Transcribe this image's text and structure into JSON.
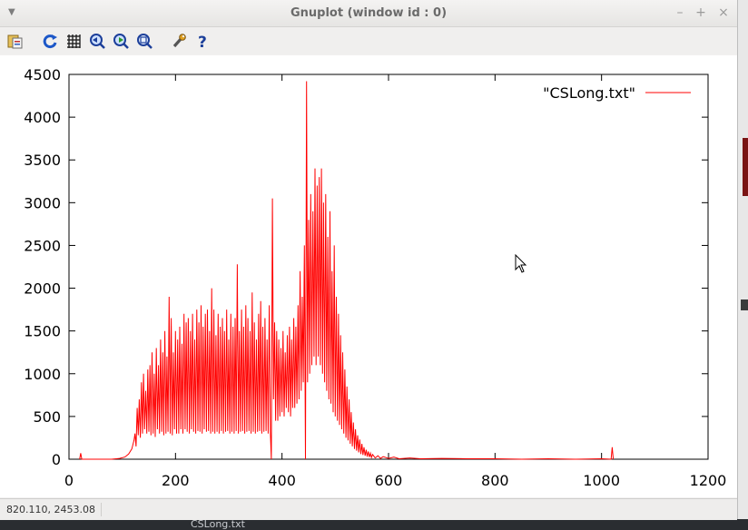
{
  "window": {
    "title": "Gnuplot (window id : 0)"
  },
  "titlebar_buttons": {
    "minimize": "–",
    "maximize": "+",
    "close": "×"
  },
  "toolbar": {
    "icons": [
      "copy-clipboard-icon",
      "replot-icon",
      "grid-icon",
      "zoom-prev-icon",
      "zoom-next-icon",
      "zoom-autoscale-icon",
      "settings-wrench-icon",
      "help-icon"
    ]
  },
  "statusbar": {
    "coords": "820.110,  2453.08"
  },
  "taskbar": {
    "label": "CSLong.txt"
  },
  "colors": {
    "series": "#ff0000",
    "window_bg": "#f2f1f0",
    "plot_bg": "#ffffff"
  },
  "chart_data": {
    "type": "line",
    "title": "",
    "xlabel": "",
    "ylabel": "",
    "xlim": [
      0,
      1200
    ],
    "ylim": [
      0,
      4500
    ],
    "xticks": [
      0,
      200,
      400,
      600,
      800,
      1000,
      1200
    ],
    "yticks": [
      0,
      500,
      1000,
      1500,
      2000,
      2500,
      3000,
      3500,
      4000,
      4500
    ],
    "grid": false,
    "legend": "top-right",
    "series": [
      {
        "name": "\"CSLong.txt\"",
        "color": "#ff0000",
        "points": [
          [
            20,
            0
          ],
          [
            22,
            70
          ],
          [
            24,
            0
          ],
          [
            40,
            0
          ],
          [
            60,
            0
          ],
          [
            80,
            0
          ],
          [
            95,
            10
          ],
          [
            105,
            25
          ],
          [
            112,
            60
          ],
          [
            118,
            120
          ],
          [
            122,
            220
          ],
          [
            124,
            300
          ],
          [
            126,
            150
          ],
          [
            128,
            600
          ],
          [
            130,
            280
          ],
          [
            132,
            700
          ],
          [
            134,
            250
          ],
          [
            136,
            900
          ],
          [
            138,
            300
          ],
          [
            140,
            1000
          ],
          [
            142,
            350
          ],
          [
            144,
            800
          ],
          [
            146,
            300
          ],
          [
            148,
            1050
          ],
          [
            150,
            320
          ],
          [
            152,
            1100
          ],
          [
            154,
            280
          ],
          [
            156,
            1250
          ],
          [
            158,
            300
          ],
          [
            160,
            1000
          ],
          [
            162,
            260
          ],
          [
            164,
            1300
          ],
          [
            166,
            350
          ],
          [
            168,
            1100
          ],
          [
            170,
            300
          ],
          [
            172,
            1400
          ],
          [
            174,
            320
          ],
          [
            176,
            1250
          ],
          [
            178,
            280
          ],
          [
            180,
            1500
          ],
          [
            182,
            300
          ],
          [
            184,
            1200
          ],
          [
            186,
            320
          ],
          [
            188,
            1900
          ],
          [
            190,
            300
          ],
          [
            192,
            1650
          ],
          [
            194,
            280
          ],
          [
            196,
            1250
          ],
          [
            198,
            350
          ],
          [
            200,
            1500
          ],
          [
            202,
            300
          ],
          [
            204,
            1400
          ],
          [
            206,
            300
          ],
          [
            208,
            1550
          ],
          [
            210,
            350
          ],
          [
            212,
            1350
          ],
          [
            214,
            300
          ],
          [
            216,
            1700
          ],
          [
            218,
            350
          ],
          [
            220,
            1600
          ],
          [
            222,
            320
          ],
          [
            224,
            1650
          ],
          [
            226,
            300
          ],
          [
            228,
            1500
          ],
          [
            230,
            350
          ],
          [
            232,
            1700
          ],
          [
            234,
            320
          ],
          [
            236,
            1400
          ],
          [
            238,
            300
          ],
          [
            240,
            1750
          ],
          [
            242,
            330
          ],
          [
            244,
            1600
          ],
          [
            246,
            320
          ],
          [
            248,
            1800
          ],
          [
            250,
            300
          ],
          [
            252,
            1550
          ],
          [
            254,
            350
          ],
          [
            256,
            1700
          ],
          [
            258,
            320
          ],
          [
            260,
            1750
          ],
          [
            262,
            330
          ],
          [
            264,
            1500
          ],
          [
            266,
            300
          ],
          [
            268,
            2000
          ],
          [
            270,
            320
          ],
          [
            272,
            1750
          ],
          [
            274,
            300
          ],
          [
            276,
            1450
          ],
          [
            278,
            320
          ],
          [
            280,
            1700
          ],
          [
            282,
            300
          ],
          [
            284,
            1550
          ],
          [
            286,
            330
          ],
          [
            288,
            1650
          ],
          [
            290,
            300
          ],
          [
            292,
            1500
          ],
          [
            294,
            320
          ],
          [
            296,
            1750
          ],
          [
            298,
            330
          ],
          [
            300,
            1400
          ],
          [
            302,
            300
          ],
          [
            304,
            1700
          ],
          [
            306,
            320
          ],
          [
            308,
            1550
          ],
          [
            310,
            300
          ],
          [
            312,
            1650
          ],
          [
            314,
            330
          ],
          [
            316,
            2280
          ],
          [
            318,
            300
          ],
          [
            320,
            1500
          ],
          [
            322,
            320
          ],
          [
            324,
            1750
          ],
          [
            326,
            330
          ],
          [
            328,
            1550
          ],
          [
            330,
            300
          ],
          [
            332,
            1800
          ],
          [
            334,
            320
          ],
          [
            336,
            1650
          ],
          [
            338,
            330
          ],
          [
            340,
            1500
          ],
          [
            342,
            300
          ],
          [
            344,
            1950
          ],
          [
            346,
            320
          ],
          [
            348,
            1600
          ],
          [
            350,
            300
          ],
          [
            352,
            1400
          ],
          [
            354,
            320
          ],
          [
            356,
            1700
          ],
          [
            358,
            330
          ],
          [
            360,
            1850
          ],
          [
            362,
            300
          ],
          [
            364,
            1550
          ],
          [
            366,
            320
          ],
          [
            368,
            1650
          ],
          [
            370,
            330
          ],
          [
            372,
            1400
          ],
          [
            374,
            300
          ],
          [
            376,
            1800
          ],
          [
            378,
            320
          ],
          [
            380,
            0
          ],
          [
            382,
            3050
          ],
          [
            384,
            700
          ],
          [
            386,
            1600
          ],
          [
            388,
            450
          ],
          [
            390,
            1500
          ],
          [
            392,
            450
          ],
          [
            394,
            1400
          ],
          [
            396,
            500
          ],
          [
            398,
            1300
          ],
          [
            400,
            550
          ],
          [
            402,
            1500
          ],
          [
            404,
            500
          ],
          [
            406,
            1250
          ],
          [
            408,
            600
          ],
          [
            410,
            1450
          ],
          [
            412,
            550
          ],
          [
            414,
            1550
          ],
          [
            416,
            500
          ],
          [
            418,
            1400
          ],
          [
            420,
            600
          ],
          [
            422,
            1650
          ],
          [
            424,
            600
          ],
          [
            426,
            1550
          ],
          [
            428,
            650
          ],
          [
            430,
            1800
          ],
          [
            432,
            700
          ],
          [
            434,
            2200
          ],
          [
            436,
            800
          ],
          [
            438,
            1900
          ],
          [
            440,
            900
          ],
          [
            442,
            2500
          ],
          [
            444,
            0
          ],
          [
            446,
            4420
          ],
          [
            448,
            900
          ],
          [
            450,
            2800
          ],
          [
            452,
            1000
          ],
          [
            454,
            3100
          ],
          [
            456,
            1100
          ],
          [
            458,
            2900
          ],
          [
            460,
            1200
          ],
          [
            462,
            3400
          ],
          [
            464,
            1100
          ],
          [
            466,
            3200
          ],
          [
            468,
            1200
          ],
          [
            470,
            3300
          ],
          [
            472,
            1100
          ],
          [
            474,
            3400
          ],
          [
            476,
            1000
          ],
          [
            478,
            3000
          ],
          [
            480,
            900
          ],
          [
            482,
            3100
          ],
          [
            484,
            800
          ],
          [
            486,
            2600
          ],
          [
            488,
            700
          ],
          [
            490,
            2900
          ],
          [
            492,
            650
          ],
          [
            494,
            2200
          ],
          [
            496,
            550
          ],
          [
            498,
            2500
          ],
          [
            500,
            500
          ],
          [
            502,
            1900
          ],
          [
            504,
            450
          ],
          [
            506,
            1700
          ],
          [
            508,
            400
          ],
          [
            510,
            1450
          ],
          [
            512,
            350
          ],
          [
            514,
            1250
          ],
          [
            516,
            300
          ],
          [
            518,
            1050
          ],
          [
            520,
            250
          ],
          [
            522,
            850
          ],
          [
            524,
            220
          ],
          [
            526,
            700
          ],
          [
            528,
            180
          ],
          [
            530,
            550
          ],
          [
            532,
            150
          ],
          [
            534,
            430
          ],
          [
            536,
            120
          ],
          [
            538,
            350
          ],
          [
            540,
            100
          ],
          [
            542,
            280
          ],
          [
            544,
            80
          ],
          [
            546,
            230
          ],
          [
            548,
            60
          ],
          [
            550,
            180
          ],
          [
            552,
            50
          ],
          [
            554,
            140
          ],
          [
            556,
            40
          ],
          [
            558,
            110
          ],
          [
            560,
            30
          ],
          [
            562,
            90
          ],
          [
            564,
            25
          ],
          [
            566,
            70
          ],
          [
            568,
            20
          ],
          [
            570,
            55
          ],
          [
            575,
            15
          ],
          [
            580,
            40
          ],
          [
            585,
            10
          ],
          [
            590,
            30
          ],
          [
            600,
            10
          ],
          [
            610,
            25
          ],
          [
            620,
            5
          ],
          [
            640,
            15
          ],
          [
            660,
            5
          ],
          [
            700,
            10
          ],
          [
            750,
            5
          ],
          [
            800,
            5
          ],
          [
            850,
            0
          ],
          [
            900,
            5
          ],
          [
            950,
            0
          ],
          [
            1000,
            5
          ],
          [
            1018,
            0
          ],
          [
            1020,
            140
          ],
          [
            1022,
            0
          ]
        ]
      }
    ]
  }
}
